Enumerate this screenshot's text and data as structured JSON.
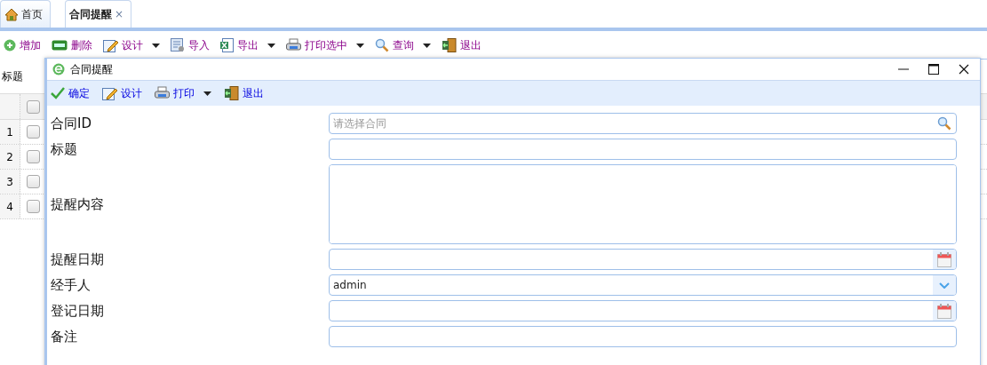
{
  "tabs": [
    {
      "label": "首页",
      "kind": "home",
      "selected": false
    },
    {
      "label": "合同提醒",
      "close": "×",
      "selected": true
    }
  ],
  "toolbar": [
    {
      "label": "增加",
      "kind": "add",
      "dropdown": false
    },
    {
      "label": "删除",
      "kind": "delete",
      "dropdown": false
    },
    {
      "label": "设计",
      "kind": "design",
      "dropdown": true
    },
    {
      "label": "导入",
      "kind": "import",
      "dropdown": false
    },
    {
      "label": "导出",
      "kind": "export",
      "dropdown": true
    },
    {
      "label": "打印选中",
      "kind": "print",
      "dropdown": true
    },
    {
      "label": "查询",
      "kind": "search",
      "dropdown": true
    },
    {
      "label": "退出",
      "kind": "exit",
      "dropdown": false
    }
  ],
  "grid": {
    "filter_label": "标题",
    "header_checked": false,
    "rows": [
      {
        "number": "1",
        "checked": false
      },
      {
        "number": "2",
        "checked": false
      },
      {
        "number": "3",
        "checked": false
      },
      {
        "number": "4",
        "checked": false
      }
    ]
  },
  "dialog": {
    "title": "合同提醒",
    "toolbar": [
      {
        "label": "确定",
        "kind": "confirm",
        "dropdown": false
      },
      {
        "label": "设计",
        "kind": "design",
        "dropdown": false
      },
      {
        "label": "打印",
        "kind": "print",
        "dropdown": true
      },
      {
        "label": "退出",
        "kind": "exit",
        "dropdown": false
      }
    ],
    "fields": [
      {
        "label": "合同ID",
        "kind": "lookup",
        "placeholder": "请选择合同"
      },
      {
        "label": "标题",
        "kind": "text"
      },
      {
        "label": "提醒内容",
        "kind": "textarea"
      },
      {
        "label": "提醒日期",
        "kind": "date"
      },
      {
        "label": "经手人",
        "kind": "combo",
        "value": "admin"
      },
      {
        "label": "登记日期",
        "kind": "date"
      },
      {
        "label": "备注",
        "kind": "text"
      }
    ]
  }
}
